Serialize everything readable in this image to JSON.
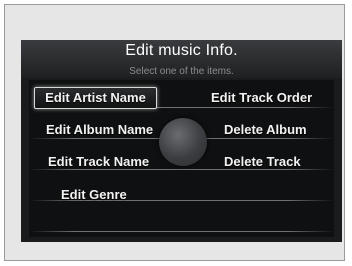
{
  "screen": {
    "title": "Edit music Info.",
    "subtitle": "Select one of the items."
  },
  "menu": {
    "items": [
      {
        "label": "Edit Artist Name",
        "selected": true
      },
      {
        "label": "Edit Track Order",
        "selected": false
      },
      {
        "label": "Edit Album Name",
        "selected": false
      },
      {
        "label": "Delete Album",
        "selected": false
      },
      {
        "label": "Edit Track Name",
        "selected": false
      },
      {
        "label": "Delete Track",
        "selected": false
      },
      {
        "label": "Edit Genre",
        "selected": false
      }
    ]
  },
  "colors": {
    "screen_bg": "#1a1b1d",
    "text": "#f2f2f2",
    "subtitle": "#8a8c90",
    "selection_border": "#d9d9d9"
  }
}
